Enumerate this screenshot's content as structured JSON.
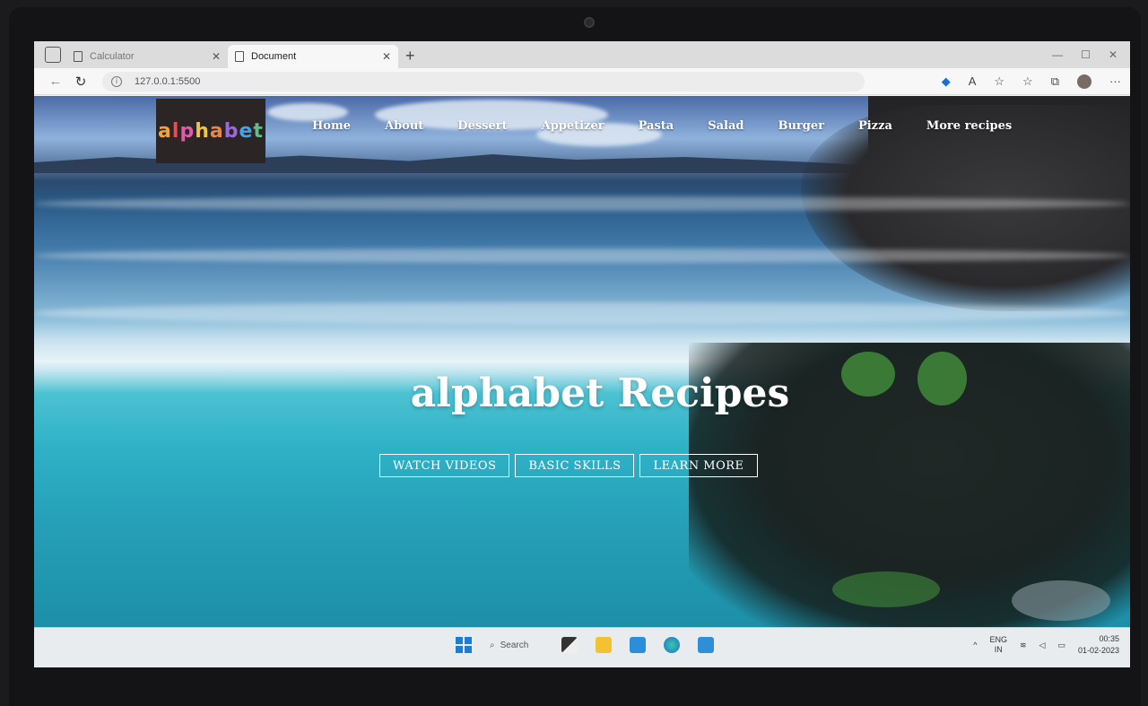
{
  "browser": {
    "tabs": [
      {
        "title": "Calculator",
        "active": false
      },
      {
        "title": "Document",
        "active": true
      }
    ],
    "new_tab_label": "+",
    "url": "127.0.0.1:5500"
  },
  "site": {
    "logo_letters": [
      {
        "char": "a",
        "color": "#f2a33a"
      },
      {
        "char": "l",
        "color": "#e05252"
      },
      {
        "char": "p",
        "color": "#e05aa6"
      },
      {
        "char": "h",
        "color": "#f0c341"
      },
      {
        "char": "a",
        "color": "#e8874a"
      },
      {
        "char": "b",
        "color": "#9a6ad8"
      },
      {
        "char": "e",
        "color": "#4aa3e0"
      },
      {
        "char": "t",
        "color": "#5bc08a"
      }
    ],
    "nav": [
      "Home",
      "About",
      "Dessert",
      "Appetizer",
      "Pasta",
      "Salad",
      "Burger",
      "Pizza",
      "More recipes"
    ],
    "hero_title": "alphabet Recipes",
    "buttons": [
      "WATCH VIDEOS",
      "BASIC SKILLS",
      "LEARN MORE"
    ]
  },
  "taskbar": {
    "search_label": "Search",
    "lang_top": "ENG",
    "lang_bottom": "IN",
    "time": "00:35",
    "date": "01-02-2023"
  }
}
